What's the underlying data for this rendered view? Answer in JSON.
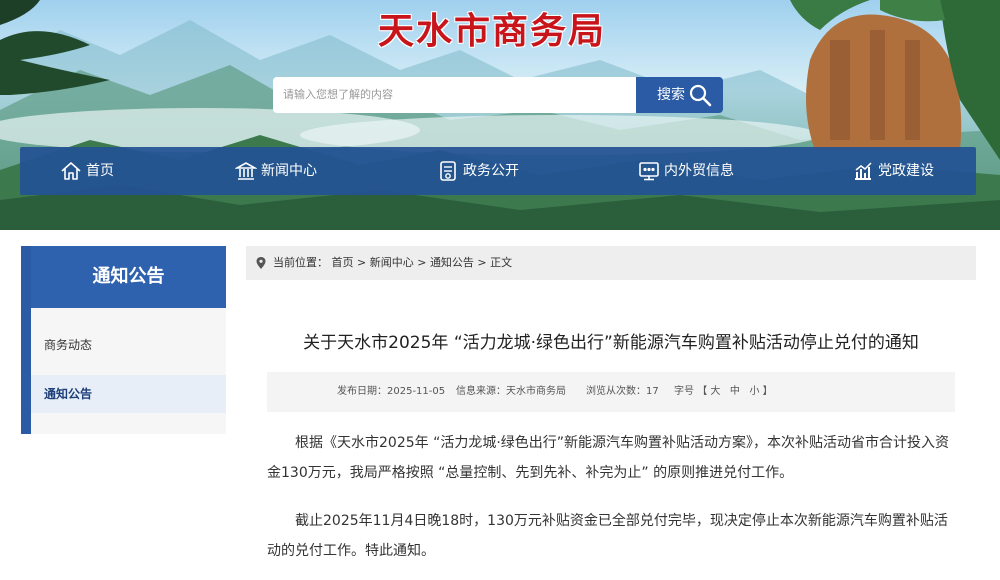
{
  "header": {
    "site_title": "天水市商务局",
    "search": {
      "placeholder": "请输入您想了解的内容",
      "button_label": "搜索"
    }
  },
  "nav": {
    "items": [
      {
        "label": "首页",
        "icon": "home-icon"
      },
      {
        "label": "新闻中心",
        "icon": "building-icon"
      },
      {
        "label": "政务公开",
        "icon": "document-icon"
      },
      {
        "label": "内外贸信息",
        "icon": "monitor-icon"
      },
      {
        "label": "党政建设",
        "icon": "chart-icon"
      }
    ]
  },
  "sidebar": {
    "title": "通知公告",
    "items": [
      {
        "label": "商务动态"
      },
      {
        "label": "通知公告",
        "active": true
      }
    ]
  },
  "breadcrumb": {
    "prefix": "当前位置：",
    "items": [
      "首页",
      "新闻中心",
      "通知公告",
      "正文"
    ],
    "sep": " > "
  },
  "article": {
    "title": "关于天水市2025年 “活力龙城·绿色出行”新能源汽车购置补贴活动停止兑付的通知",
    "meta": {
      "date_label": "发布日期：",
      "date": "2025-11-05",
      "source_label": "信息来源：",
      "source": "天水市商务局",
      "views_label": "浏览从次数：",
      "views": "17",
      "font_label": "字号",
      "font_open": "【",
      "font_close": "】",
      "font_sizes": [
        "大",
        "中",
        "小"
      ]
    },
    "paragraphs": [
      "根据《天水市2025年 “活力龙城·绿色出行”新能源汽车购置补贴活动方案》，本次补贴活动省市合计投入资金130万元，我局严格按照 “总量控制、先到先补、补完为止” 的原则推进兑付工作。",
      "截止2025年11月4日晚18时，130万元补贴资金已全部兑付完毕，现决定停止本次新能源汽车购置补贴活动的兑付工作。特此通知。"
    ]
  },
  "colors": {
    "primary": "#2a5ba4",
    "title_red": "#c8151b",
    "sidebar_head": "#2f62ae"
  }
}
